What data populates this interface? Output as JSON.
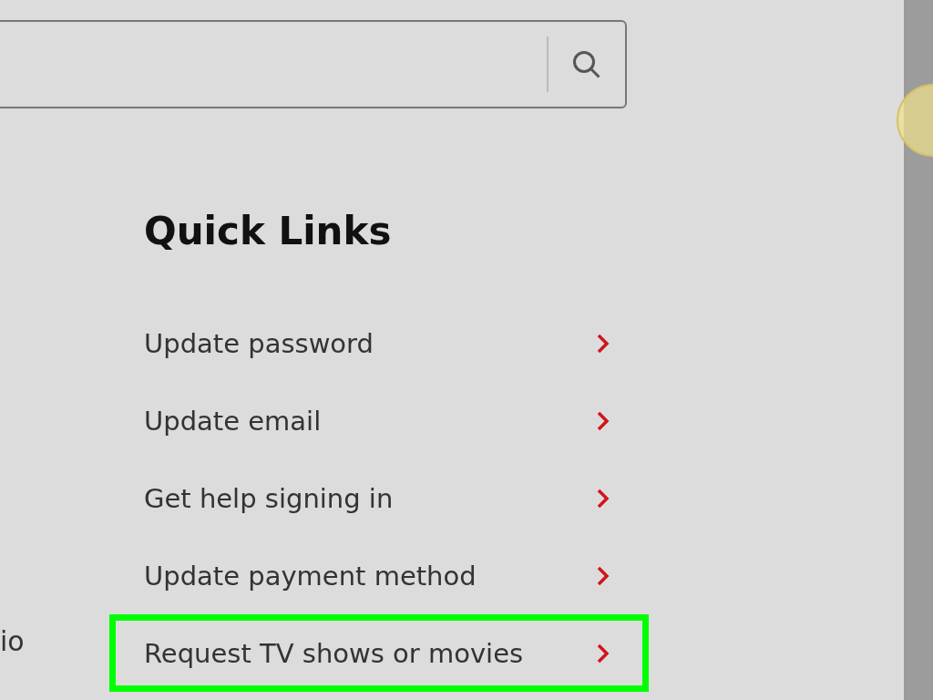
{
  "quick_links": {
    "title": "Quick Links",
    "items": [
      {
        "label": "Update password",
        "highlighted": false
      },
      {
        "label": "Update email",
        "highlighted": false
      },
      {
        "label": "Get help signing in",
        "highlighted": false
      },
      {
        "label": "Update payment method",
        "highlighted": false
      },
      {
        "label": "Request TV shows or movies",
        "highlighted": true
      }
    ]
  },
  "left_column": {
    "text": "io"
  }
}
